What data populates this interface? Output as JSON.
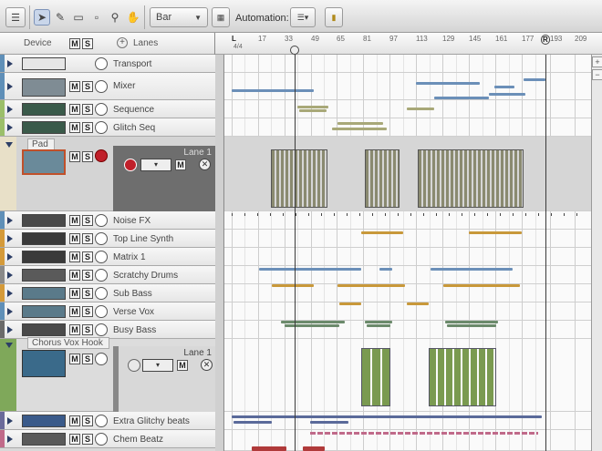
{
  "toolbar": {
    "snap_value": "Bar",
    "automation_label": "Automation:"
  },
  "header": {
    "device_label": "Device",
    "mute_label": "M",
    "solo_label": "S",
    "lanes_label": "Lanes",
    "time_signature": "4/4",
    "left_locator": "L",
    "right_locator": "R",
    "ruler_ticks": [
      "17",
      "33",
      "49",
      "65",
      "81",
      "97",
      "113",
      "129",
      "145",
      "161",
      "177",
      "193",
      "209"
    ]
  },
  "tracks": [
    {
      "name": "Transport",
      "color": "#5f8fb8"
    },
    {
      "name": "Mixer",
      "color": "#5f8fb8"
    },
    {
      "name": "Sequence",
      "color": "#9bbf6a"
    },
    {
      "name": "Glitch Seq",
      "color": "#9bbf6a"
    },
    {
      "name": "Pad",
      "color": "#e8e0c8",
      "lane_label": "Lane 1"
    },
    {
      "name": "Noise FX",
      "color": "#5f8fb8"
    },
    {
      "name": "Top Line Synth",
      "color": "#d49a3a"
    },
    {
      "name": "Matrix 1",
      "color": "#d49a3a"
    },
    {
      "name": "Scratchy Drums",
      "color": "#8a8a8a"
    },
    {
      "name": "Sub Bass",
      "color": "#d49a3a"
    },
    {
      "name": "Verse Vox",
      "color": "#5f8fb8"
    },
    {
      "name": "Busy Bass",
      "color": "#6a6a6a"
    },
    {
      "name": "Chorus Vox Hook",
      "color": "#7fa85a",
      "lane_label": "Lane 1"
    },
    {
      "name": "Extra Glitchy beats",
      "color": "#6a6a9a"
    },
    {
      "name": "Chem Beatz",
      "color": "#c06a8a"
    }
  ],
  "colors": {
    "mixer_clip": "#6b8fb8",
    "sequence_clip": "#a8a878",
    "pad_clip": "#8a8a70",
    "synth_clip": "#c8983a",
    "drum_clip": "#6b8fb8",
    "vox_clip": "#6b8a6b",
    "bass_clip": "#6a6a6a",
    "chorus_clip": "#7a9a50",
    "glitch_clip": "#5a6a9a",
    "chem_clip": "#c06a8a"
  }
}
